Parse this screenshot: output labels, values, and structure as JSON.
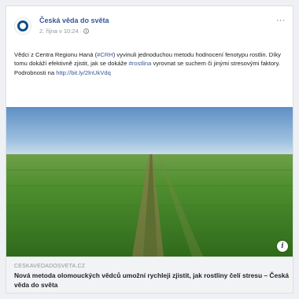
{
  "post": {
    "page_name": "Česká věda do světa",
    "timestamp": "2. října v 10:24",
    "separator": "·",
    "more_label": "···",
    "text": {
      "p1": "Vědci z Centra Regionu Haná (",
      "hashtag_crh": "#CRH",
      "p2": ") vyvinuli jednoduchou metodu hodnocení fenotypu rostlin. Díky tomu dokáží efektivně zjistit, jak se dokáže ",
      "hashtag_rostlina": "#rostlina",
      "p3": " vyrovnat se suchem či jinými stresovými faktory. Podrobnosti na ",
      "url": "http://bit.ly/2lnUkVdq"
    },
    "info_label": "i"
  },
  "link_preview": {
    "domain": "CESKAVEDADOSVETA.CZ",
    "headline": "Nová metoda olomouckých vědců umožní rychleji zjistit, jak rostliny čelí stresu – Česká věda do světa"
  },
  "colors": {
    "page_name": "#365899",
    "link": "#385898",
    "sky_top": "#5e8fc4",
    "field": "#4f8f2f"
  }
}
